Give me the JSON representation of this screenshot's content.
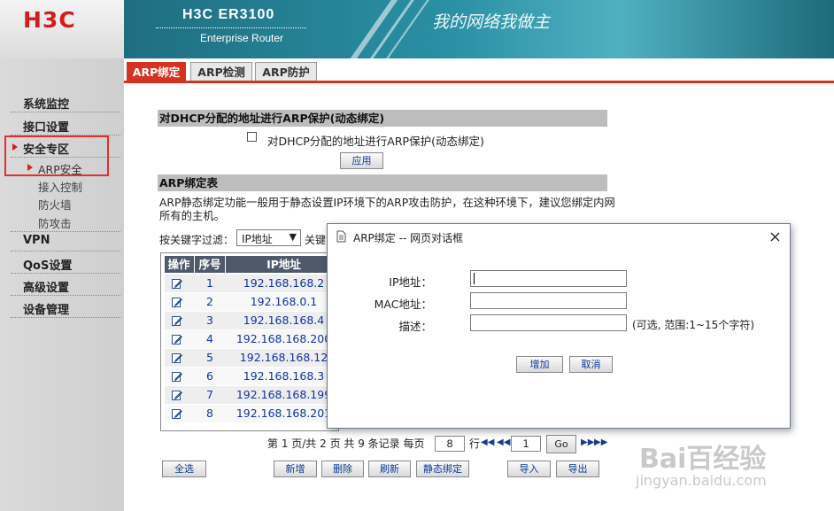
{
  "brand": {
    "logo": "H3C",
    "product": "H3C ER3100",
    "subtitle": "Enterprise Router",
    "slogan": "我的网络我做主"
  },
  "sidebar": {
    "items": [
      {
        "label": "系统监控"
      },
      {
        "label": "接口设置"
      },
      {
        "label": "安全专区"
      },
      {
        "label": "ARP安全"
      },
      {
        "label": "接入控制"
      },
      {
        "label": "防火墙"
      },
      {
        "label": "防攻击"
      },
      {
        "label": "VPN"
      },
      {
        "label": "QoS设置"
      },
      {
        "label": "高级设置"
      },
      {
        "label": "设备管理"
      }
    ]
  },
  "tabs": [
    {
      "label": "ARP绑定",
      "active": true
    },
    {
      "label": "ARP检测",
      "active": false
    },
    {
      "label": "ARP防护",
      "active": false
    }
  ],
  "dhcp_section": {
    "header": "对DHCP分配的地址进行ARP保护(动态绑定)",
    "checkbox_label": "对DHCP分配的地址进行ARP保护(动态绑定)",
    "apply_button": "应用"
  },
  "binding_table": {
    "header": "ARP绑定表",
    "description_line1": "ARP静态绑定功能一般用于静态设置IP环境下的ARP攻击防护，在这种环境下，建议您绑定内网",
    "description_line2": "所有的主机。",
    "filter_label": "按关键字过滤：",
    "filter_select": "IP地址",
    "filter_trailing": "关键",
    "columns": [
      "操作",
      "序号",
      "IP地址"
    ],
    "rows": [
      {
        "index": "1",
        "ip": "192.168.168.2"
      },
      {
        "index": "2",
        "ip": "192.168.0.1"
      },
      {
        "index": "3",
        "ip": "192.168.168.4"
      },
      {
        "index": "4",
        "ip": "192.168.168.200"
      },
      {
        "index": "5",
        "ip": "192.168.168.12"
      },
      {
        "index": "6",
        "ip": "192.168.168.3"
      },
      {
        "index": "7",
        "ip": "192.168.168.199"
      },
      {
        "index": "8",
        "ip": "192.168.168.201"
      }
    ],
    "pager": {
      "summary": "第 1 页/共 2 页 共 9 条记录 每页",
      "per_page": "8",
      "rows_unit": "行",
      "page_input": "1",
      "go_button": "Go"
    },
    "buttons": {
      "select_all": "全选",
      "add": "新增",
      "delete": "删除",
      "refresh": "刷新",
      "static_bind": "静态绑定",
      "import": "导入",
      "export": "导出"
    }
  },
  "dialog": {
    "title": "ARP绑定 -- 网页对话框",
    "ip_label": "IP地址：",
    "mac_label": "MAC地址：",
    "desc_label": "描述：",
    "desc_hint": "(可选, 范围:1~15个字符)",
    "add_button": "增加",
    "cancel_button": "取消"
  },
  "watermark": {
    "brand": "Bai百经验",
    "url": "jingyan.baidu.com"
  },
  "colors": {
    "accent_red": "#d43322",
    "banner": "#2a8fa4",
    "link_blue": "#1133aa"
  }
}
